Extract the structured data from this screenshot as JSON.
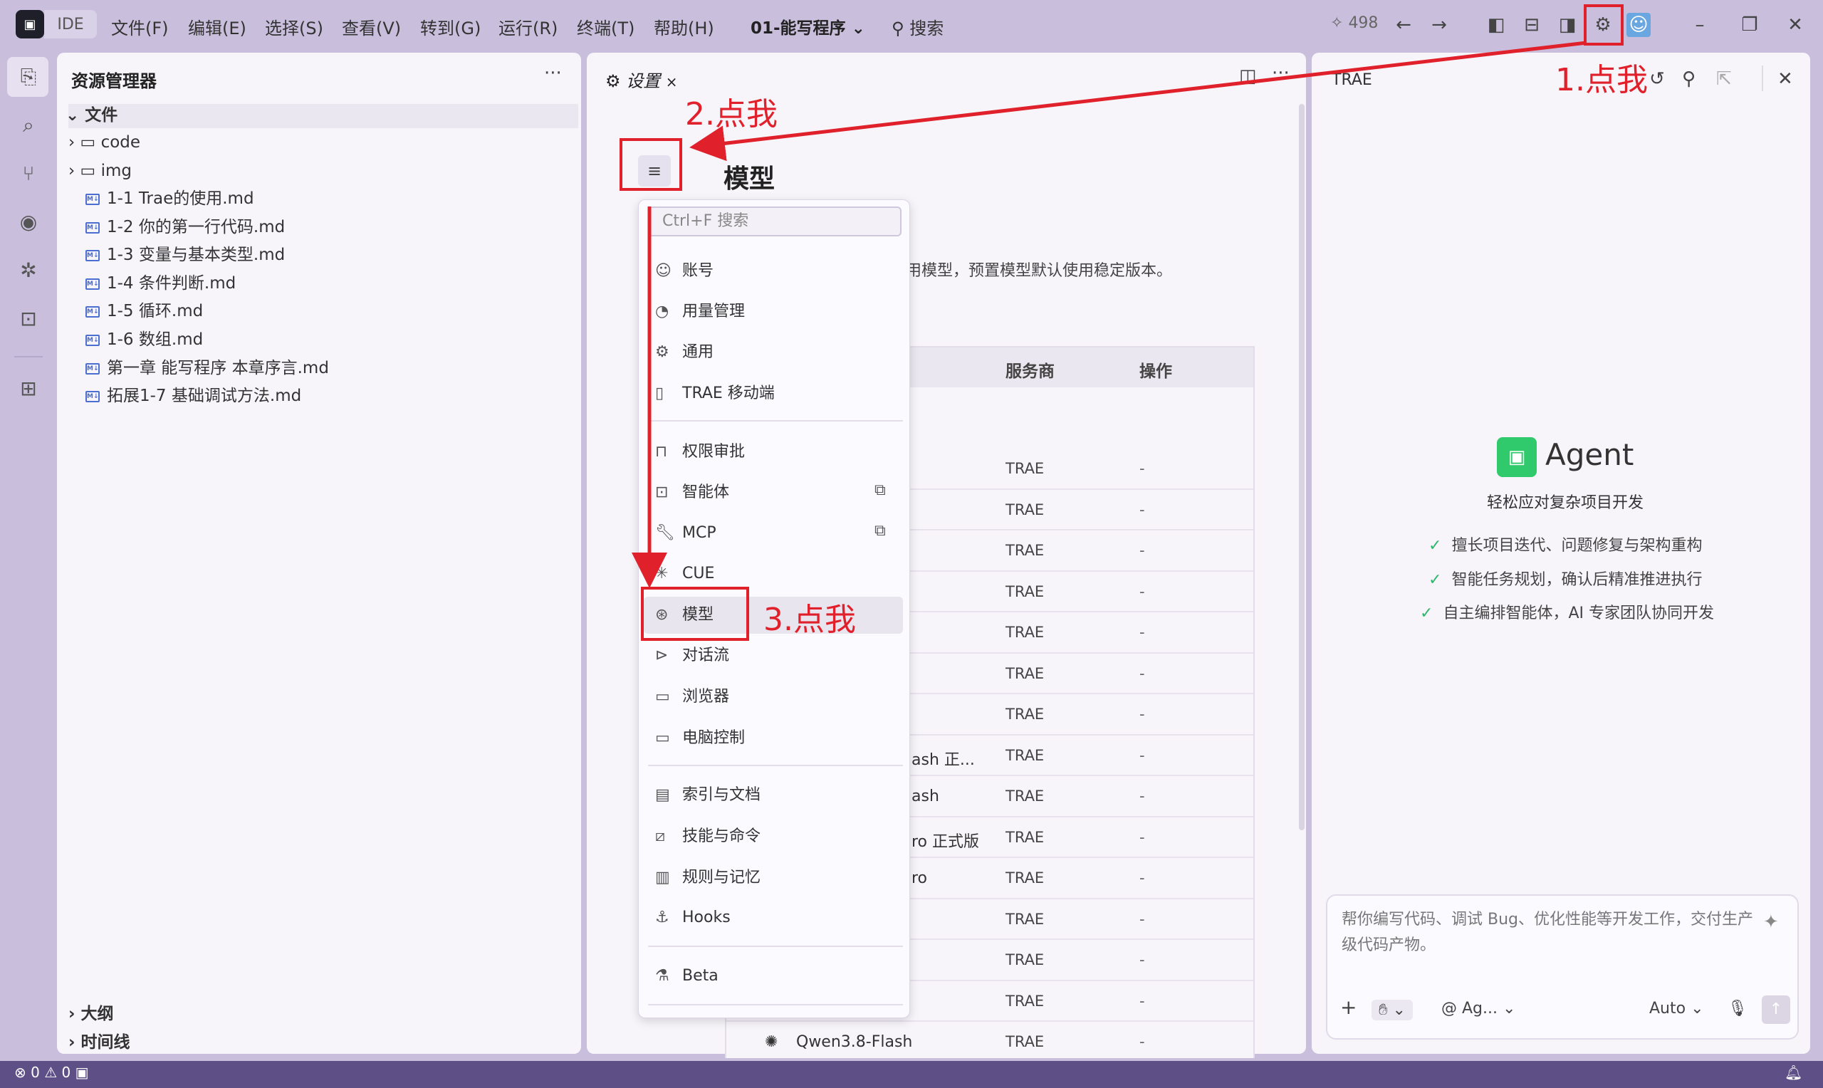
{
  "titlebar": {
    "logo": "IDE",
    "menu": [
      "文件(F)",
      "编辑(E)",
      "选择(S)",
      "查看(V)",
      "转到(G)",
      "运行(R)",
      "终端(T)",
      "帮助(H)"
    ],
    "project": "01-能写程序",
    "search": "搜索",
    "credits": "498"
  },
  "explorer": {
    "title": "资源管理器",
    "more": "···",
    "section": "文件",
    "folders": [
      "code",
      "img"
    ],
    "files": [
      "1-1 Trae的使用.md",
      "1-2 你的第一行代码.md",
      "1-3 变量与基本类型.md",
      "1-4 条件判断.md",
      "1-5 循环.md",
      "1-6 数组.md",
      "第一章 能写程序 本章序言.md",
      "拓展1-7 基础调试方法.md"
    ],
    "bottom": [
      "大纲",
      "时间线"
    ]
  },
  "editor": {
    "tab": "设置",
    "section_title": "模型",
    "description": "用模型，预置模型默认使用稳定版本。",
    "table": {
      "headers": [
        "服务商",
        "操作"
      ],
      "rows": [
        {
          "name": "",
          "provider": "TRAE",
          "op": "-"
        },
        {
          "name": "",
          "provider": "TRAE",
          "op": "-"
        },
        {
          "name": "",
          "provider": "TRAE",
          "op": "-"
        },
        {
          "name": "",
          "provider": "TRAE",
          "op": "-"
        },
        {
          "name": "",
          "provider": "TRAE",
          "op": "-"
        },
        {
          "name": "",
          "provider": "TRAE",
          "op": "-"
        },
        {
          "name": "",
          "provider": "TRAE",
          "op": "-"
        },
        {
          "name": "ash 正...",
          "provider": "TRAE",
          "op": "-"
        },
        {
          "name": "ash",
          "provider": "TRAE",
          "op": "-"
        },
        {
          "name": "ro 正式版",
          "provider": "TRAE",
          "op": "-"
        },
        {
          "name": "ro",
          "provider": "TRAE",
          "op": "-"
        },
        {
          "name": "",
          "provider": "TRAE",
          "op": "-"
        },
        {
          "name": "",
          "provider": "TRAE",
          "op": "-"
        },
        {
          "name": "",
          "provider": "TRAE",
          "op": "-"
        },
        {
          "name": "Qwen3.8-Flash",
          "provider": "TRAE",
          "op": "-"
        }
      ]
    }
  },
  "dropdown": {
    "search_placeholder": "Ctrl+F 搜索",
    "group1": [
      "账号",
      "用量管理",
      "通用",
      "TRAE 移动端"
    ],
    "group2": [
      "权限审批",
      "智能体",
      "MCP",
      "CUE",
      "模型",
      "对话流",
      "浏览器",
      "电脑控制"
    ],
    "group3": [
      "索引与文档",
      "技能与命令",
      "规则与记忆",
      "Hooks"
    ],
    "group4": [
      "Beta"
    ]
  },
  "agent_panel": {
    "title": "TRAE",
    "agent_name": "Agent",
    "subtitle": "轻松应对复杂项目开发",
    "features": [
      "擅长项目迭代、问题修复与架构重构",
      "智能任务规划，确认后精准推进执行",
      "自主编排智能体，AI 专家团队协同开发"
    ],
    "input_placeholder": "帮你编写代码、调试 Bug、优化性能等开发工作，交付生产级代码产物。",
    "agent_selector": "@ Ag...",
    "mode": "Auto"
  },
  "statusbar": {
    "errors": "0",
    "warnings": "0"
  },
  "annotations": {
    "step1": "1.点我",
    "step2": "2.点我",
    "step3": "3.点我"
  },
  "colors": {
    "annotation_red": "#e0202a",
    "statusbar": "#5e4f86",
    "agent_green": "#30c96b"
  }
}
